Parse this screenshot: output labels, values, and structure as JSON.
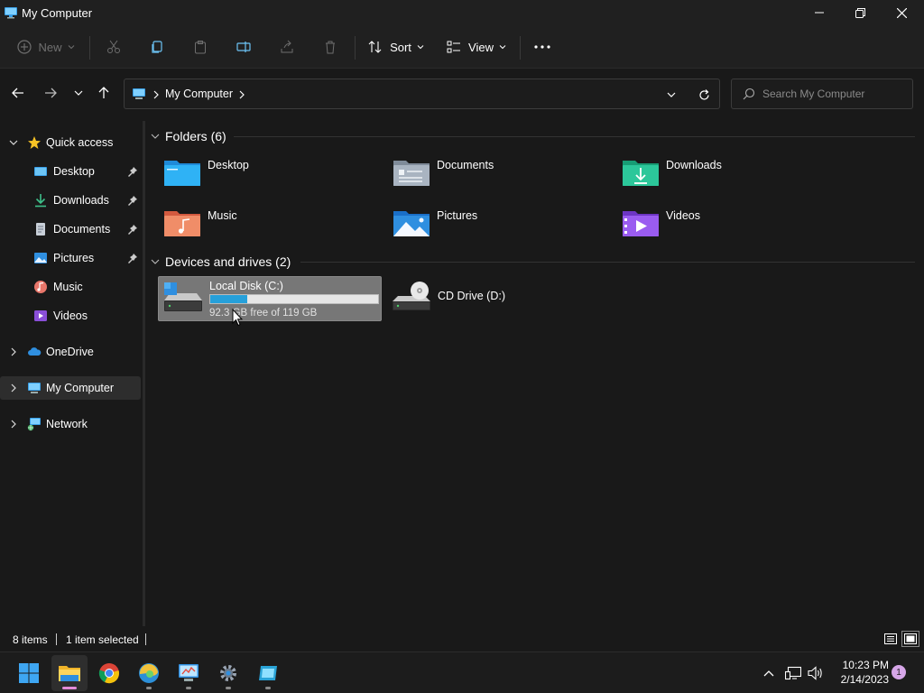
{
  "window": {
    "title": "My Computer"
  },
  "toolbar": {
    "new_label": "New",
    "sort_label": "Sort",
    "view_label": "View"
  },
  "address": {
    "path": "My Computer"
  },
  "search": {
    "placeholder": "Search My Computer"
  },
  "sidebar": {
    "quick_access": "Quick access",
    "items": [
      {
        "label": "Desktop",
        "pinned": true
      },
      {
        "label": "Downloads",
        "pinned": true
      },
      {
        "label": "Documents",
        "pinned": true
      },
      {
        "label": "Pictures",
        "pinned": true
      },
      {
        "label": "Music",
        "pinned": false
      },
      {
        "label": "Videos",
        "pinned": false
      }
    ],
    "onedrive": "OneDrive",
    "my_computer": "My Computer",
    "network": "Network"
  },
  "folders": {
    "header": "Folders (6)",
    "items": [
      {
        "label": "Desktop"
      },
      {
        "label": "Documents"
      },
      {
        "label": "Downloads"
      },
      {
        "label": "Music"
      },
      {
        "label": "Pictures"
      },
      {
        "label": "Videos"
      }
    ]
  },
  "drives": {
    "header": "Devices and drives (2)",
    "items": [
      {
        "label": "Local Disk (C:)",
        "free_text": "92.3 GB free of 119 GB",
        "used_fraction": 0.22,
        "selected": true
      },
      {
        "label": "CD Drive (D:)"
      }
    ]
  },
  "status": {
    "item_count": "8 items",
    "selection": "1 item selected"
  },
  "taskbar": {
    "time": "10:23 PM",
    "date": "2/14/2023",
    "notification_count": "1"
  },
  "colors": {
    "accent": "#26a0da",
    "window_bg": "#191919",
    "chrome_bg": "#202020",
    "selection_bg": "#777777"
  }
}
